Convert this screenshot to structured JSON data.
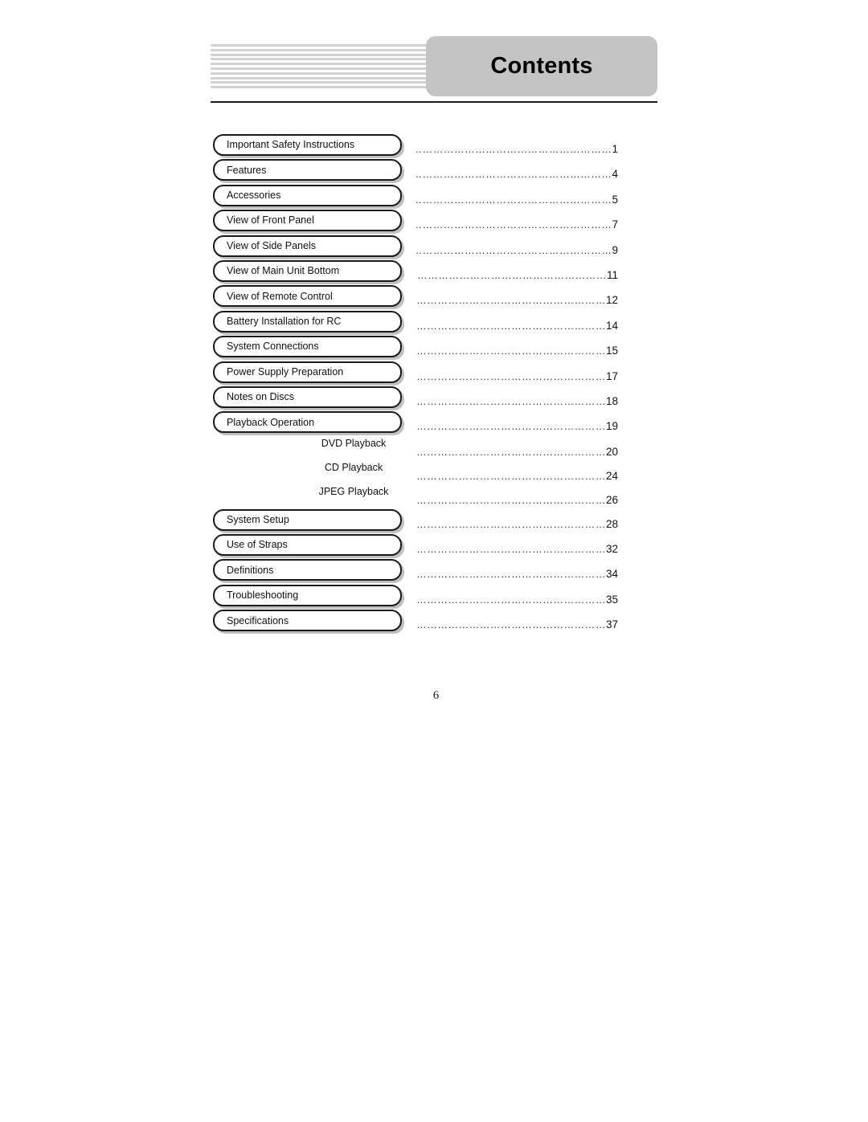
{
  "document": {
    "header": {
      "title": "Contents",
      "title_box_color": "#c4c4c4",
      "stripe_color": "#d2d2d2",
      "stripe_count": 10,
      "rule_color": "#1a1a1a"
    },
    "folio": "6",
    "leader_char": "…",
    "toc": {
      "entries": [
        {
          "label": "Important Safety Instructions",
          "page": "1",
          "level": 1
        },
        {
          "label": "Features",
          "page": "4",
          "level": 1
        },
        {
          "label": "Accessories",
          "page": "5",
          "level": 1
        },
        {
          "label": "View of Front Panel",
          "page": "7",
          "level": 1
        },
        {
          "label": "View of Side Panels",
          "page": "9",
          "level": 1
        },
        {
          "label": "View of Main Unit Bottom",
          "page": "11",
          "level": 1
        },
        {
          "label": "View of Remote Control",
          "page": "12",
          "level": 1
        },
        {
          "label": "Battery Installation for RC",
          "page": "14",
          "level": 1
        },
        {
          "label": "System Connections",
          "page": "15",
          "level": 1
        },
        {
          "label": "Power Supply Preparation",
          "page": "17",
          "level": 1
        },
        {
          "label": "Notes on Discs",
          "page": "18",
          "level": 1
        },
        {
          "label": "Playback Operation",
          "page": "19",
          "level": 1
        },
        {
          "label": "DVD Playback",
          "page": "20",
          "level": 2
        },
        {
          "label": "CD Playback",
          "page": "24",
          "level": 2
        },
        {
          "label": "JPEG Playback",
          "page": "26",
          "level": 2
        },
        {
          "label": "System Setup",
          "page": "28",
          "level": 1
        },
        {
          "label": "Use of Straps",
          "page": "32",
          "level": 1
        },
        {
          "label": "Definitions",
          "page": "34",
          "level": 1
        },
        {
          "label": "Troubleshooting",
          "page": "35",
          "level": 1
        },
        {
          "label": "Specifications",
          "page": "37",
          "level": 1
        }
      ]
    }
  }
}
